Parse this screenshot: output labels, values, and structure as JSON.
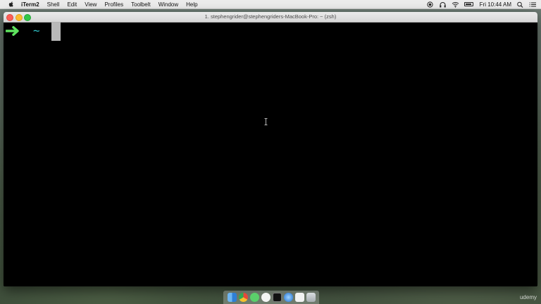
{
  "menubar": {
    "app_name": "iTerm2",
    "items": [
      "Shell",
      "Edit",
      "View",
      "Profiles",
      "Toolbelt",
      "Window",
      "Help"
    ],
    "clock": "Fri 10:44 AM",
    "status_icons": [
      "record-icon",
      "headphones-icon",
      "wifi-icon",
      "battery-icon",
      "search-icon",
      "list-icon"
    ]
  },
  "window": {
    "title": "1. stephengrider@stephengriders-MacBook-Pro: ~ (zsh)"
  },
  "terminal": {
    "prompt_dir": "~",
    "colors": {
      "arrow": "#5fe35f",
      "dir": "#2ec1c6",
      "cursor": "#b9b9b9",
      "background": "#000000"
    }
  },
  "dock": {
    "icons": [
      "finder-icon",
      "chrome-icon",
      "messages-icon",
      "emoji-icon",
      "terminal-icon",
      "safari-icon",
      "files-icon",
      "trash-icon"
    ]
  },
  "watermark": "udemy"
}
